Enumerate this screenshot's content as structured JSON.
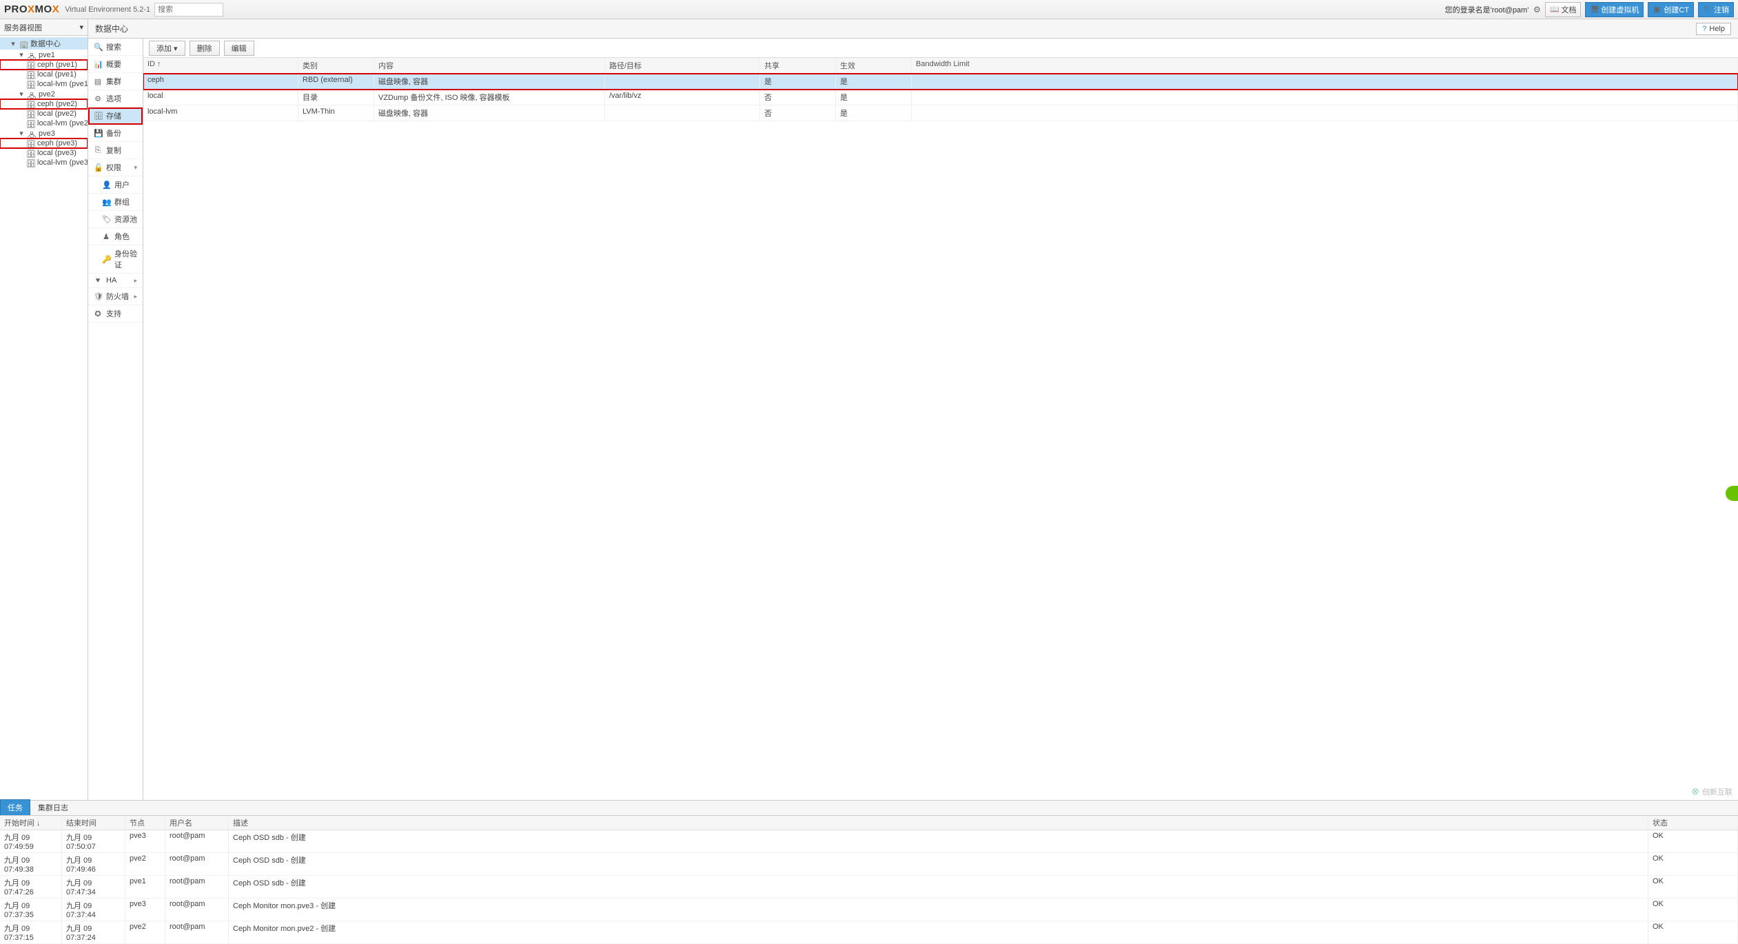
{
  "header": {
    "logo_pre": "PRO",
    "logo_mid": "X",
    "logo_post": "MO",
    "ver": "Virtual Environment 5.2-1",
    "search_placeholder": "搜索",
    "login_text": "您的登录名是'root@pam'",
    "doc": "文档",
    "create_vm": "创建虚拟机",
    "create_ct": "创建CT",
    "logout": "注销"
  },
  "view_selector": "服务器视图",
  "tree": {
    "dc": "数据中心",
    "nodes": [
      {
        "name": "pve1",
        "children": [
          {
            "label": "ceph (pve1)",
            "hl": true
          },
          {
            "label": "local (pve1)"
          },
          {
            "label": "local-lvm (pve1)"
          }
        ]
      },
      {
        "name": "pve2",
        "children": [
          {
            "label": "ceph (pve2)",
            "hl": true
          },
          {
            "label": "local (pve2)"
          },
          {
            "label": "local-lvm (pve2)"
          }
        ]
      },
      {
        "name": "pve3",
        "children": [
          {
            "label": "ceph (pve3)",
            "hl": true
          },
          {
            "label": "local (pve3)"
          },
          {
            "label": "local-lvm (pve3)"
          }
        ]
      }
    ]
  },
  "crumb": "数据中心",
  "help": "Help",
  "menu": {
    "search": "搜索",
    "summary": "概要",
    "cluster": "集群",
    "options": "选项",
    "storage": "存储",
    "backup": "备份",
    "replication": "复制",
    "permissions": "权限",
    "users": "用户",
    "groups": "群组",
    "pools": "资源池",
    "roles": "角色",
    "auth": "身份验证",
    "ha": "HA",
    "firewall": "防火墙",
    "support": "支持"
  },
  "toolbar": {
    "add": "添加",
    "remove": "删除",
    "edit": "编辑"
  },
  "grid": {
    "cols": {
      "id": "ID ↑",
      "type": "类别",
      "content": "内容",
      "path": "路径/目标",
      "shared": "共享",
      "enabled": "生效",
      "bw": "Bandwidth Limit"
    },
    "rows": [
      {
        "id": "ceph",
        "type": "RBD (external)",
        "content": "磁盘映像, 容器",
        "path": "",
        "shared": "是",
        "enabled": "是",
        "selected": true,
        "hl": true
      },
      {
        "id": "local",
        "type": "目录",
        "content": "VZDump 备份文件, ISO 映像, 容器模板",
        "path": "/var/lib/vz",
        "shared": "否",
        "enabled": "是"
      },
      {
        "id": "local-lvm",
        "type": "LVM-Thin",
        "content": "磁盘映像, 容器",
        "path": "",
        "shared": "否",
        "enabled": "是"
      }
    ]
  },
  "tasks": {
    "tab_tasks": "任务",
    "tab_cluster": "集群日志",
    "cols": {
      "start": "开始时间 ↓",
      "end": "结束时间",
      "node": "节点",
      "user": "用户名",
      "desc": "描述",
      "status": "状态"
    },
    "rows": [
      {
        "start": "九月 09 07:49:59",
        "end": "九月 09 07:50:07",
        "node": "pve3",
        "user": "root@pam",
        "desc": "Ceph OSD sdb - 创建",
        "status": "OK"
      },
      {
        "start": "九月 09 07:49:38",
        "end": "九月 09 07:49:46",
        "node": "pve2",
        "user": "root@pam",
        "desc": "Ceph OSD sdb - 创建",
        "status": "OK"
      },
      {
        "start": "九月 09 07:47:26",
        "end": "九月 09 07:47:34",
        "node": "pve1",
        "user": "root@pam",
        "desc": "Ceph OSD sdb - 创建",
        "status": "OK"
      },
      {
        "start": "九月 09 07:37:35",
        "end": "九月 09 07:37:44",
        "node": "pve3",
        "user": "root@pam",
        "desc": "Ceph Monitor mon.pve3 - 创建",
        "status": "OK"
      },
      {
        "start": "九月 09 07:37:15",
        "end": "九月 09 07:37:24",
        "node": "pve2",
        "user": "root@pam",
        "desc": "Ceph Monitor mon.pve2 - 创建",
        "status": "OK"
      }
    ]
  },
  "watermark": "创新互联"
}
